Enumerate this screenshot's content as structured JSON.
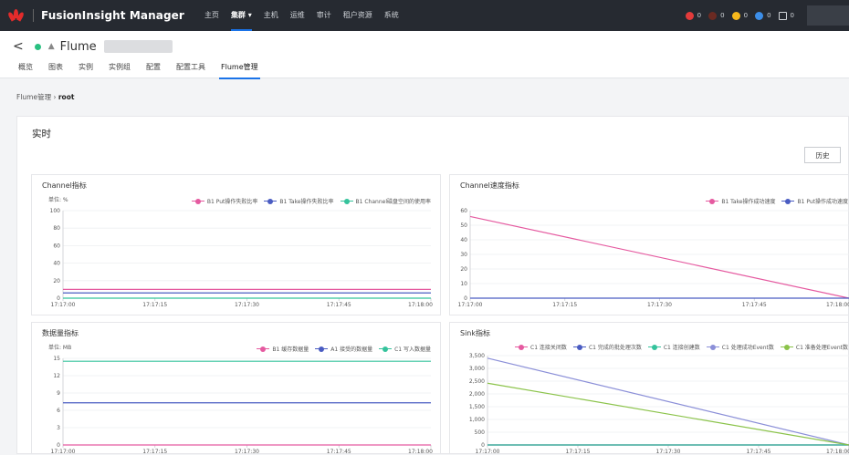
{
  "topbar": {
    "brand": "FusionInsight Manager",
    "nav": [
      "主页",
      "集群 ▾",
      "主机",
      "运维",
      "审计",
      "租户资源",
      "系统"
    ],
    "active_nav": 1,
    "alarms": [
      {
        "color": "#e33b3b",
        "count": "0"
      },
      {
        "color": "#6a2a22",
        "count": "0"
      },
      {
        "color": "#f6b81c",
        "count": "0"
      },
      {
        "color": "#3c8ee8",
        "count": "0"
      },
      {
        "color": "#262a31",
        "count": "0",
        "icon": "list-icon"
      }
    ]
  },
  "service": {
    "name": "Flume"
  },
  "tabs": [
    "概览",
    "图表",
    "实例",
    "实例组",
    "配置",
    "配置工具",
    "Flume管理"
  ],
  "active_tab": 6,
  "breadcrumb": {
    "parent": "Flume管理",
    "current": "root"
  },
  "panel": {
    "title": "实时",
    "history_button": "历史"
  },
  "charts": [
    {
      "title": "Channel指标",
      "unit": "单位: %",
      "xticks": [
        "17:17:00",
        "17:17:15",
        "17:17:30",
        "17:17:45",
        "17:18:00"
      ],
      "yticks": [
        "0",
        "20",
        "40",
        "60",
        "80",
        "100"
      ],
      "legend": [
        {
          "name": "B1 Put操作失败比率",
          "color": "#e55aa0"
        },
        {
          "name": "B1 Take操作失败比率",
          "color": "#4a5cc2"
        },
        {
          "name": "B1 Channel磁盘空间的使用率",
          "color": "#35c39c"
        }
      ]
    },
    {
      "title": "Channel速度指标",
      "unit": "",
      "xticks": [
        "17:17:00",
        "17:17:15",
        "17:17:30",
        "17:17:45",
        "17:18:00"
      ],
      "yticks": [
        "0",
        "10",
        "20",
        "30",
        "40",
        "50",
        "60"
      ],
      "legend": [
        {
          "name": "B1 Take操作成功速度",
          "color": "#e55aa0"
        },
        {
          "name": "B1 Put操作成功速度",
          "color": "#4a5cc2"
        }
      ]
    },
    {
      "title": "数据量指标",
      "unit": "单位: MB",
      "xticks": [
        "17:17:00",
        "17:17:15",
        "17:17:30",
        "17:17:45",
        "17:18:00"
      ],
      "yticks": [
        "0",
        "3",
        "6",
        "9",
        "12",
        "15"
      ],
      "legend": [
        {
          "name": "B1 缓存数据量",
          "color": "#e55aa0"
        },
        {
          "name": "A1 接受的数据量",
          "color": "#4a5cc2"
        },
        {
          "name": "C1 写入数据量",
          "color": "#35c39c"
        }
      ]
    },
    {
      "title": "Sink指标",
      "unit": "",
      "xticks": [
        "17:17:00",
        "17:17:15",
        "17:17:30",
        "17:17:45",
        "17:18:00"
      ],
      "yticks": [
        "0",
        "500",
        "1,000",
        "1,500",
        "2,000",
        "2,500",
        "3,000",
        "3,500"
      ],
      "legend": [
        {
          "name": "C1 连接关闭数",
          "color": "#e55aa0"
        },
        {
          "name": "C1 完成的批处理次数",
          "color": "#4a5cc2"
        },
        {
          "name": "C1 连接创建数",
          "color": "#35c39c"
        },
        {
          "name": "C1 处理成功Event数",
          "color": "#8b8fd8"
        },
        {
          "name": "C1 准备处理Event数",
          "color": "#8bc34a"
        }
      ]
    }
  ],
  "chart_data": [
    {
      "type": "line",
      "title": "Channel指标",
      "ylabel": "单位: %",
      "x": [
        "17:17:00",
        "17:18:00"
      ],
      "ylim": [
        0,
        100
      ],
      "series": [
        {
          "name": "B1 Put操作失败比率",
          "values": [
            10,
            10
          ]
        },
        {
          "name": "B1 Take操作失败比率",
          "values": [
            6,
            6
          ]
        },
        {
          "name": "B1 Channel磁盘空间的使用率",
          "values": [
            0,
            0
          ]
        }
      ]
    },
    {
      "type": "line",
      "title": "Channel速度指标",
      "x": [
        "17:17:00",
        "17:18:00"
      ],
      "ylim": [
        0,
        60
      ],
      "series": [
        {
          "name": "B1 Take操作成功速度",
          "values": [
            56,
            0
          ]
        },
        {
          "name": "B1 Put操作成功速度",
          "values": [
            0,
            0
          ]
        }
      ]
    },
    {
      "type": "line",
      "title": "数据量指标",
      "ylabel": "单位: MB",
      "x": [
        "17:17:00",
        "17:18:00"
      ],
      "ylim": [
        0,
        15
      ],
      "series": [
        {
          "name": "B1 缓存数据量",
          "values": [
            0,
            0
          ]
        },
        {
          "name": "A1 接受的数据量",
          "values": [
            7.3,
            7.3
          ]
        },
        {
          "name": "C1 写入数据量",
          "values": [
            14.5,
            14.5
          ]
        }
      ]
    },
    {
      "type": "line",
      "title": "Sink指标",
      "x": [
        "17:17:00",
        "17:18:00"
      ],
      "ylim": [
        0,
        3500
      ],
      "series": [
        {
          "name": "C1 连接关闭数",
          "values": [
            0,
            0
          ]
        },
        {
          "name": "C1 完成的批处理次数",
          "values": [
            0,
            0
          ]
        },
        {
          "name": "C1 连接创建数",
          "values": [
            0,
            0
          ]
        },
        {
          "name": "C1 处理成功Event数",
          "values": [
            3400,
            0
          ]
        },
        {
          "name": "C1 准备处理Event数",
          "values": [
            2420,
            0
          ]
        }
      ]
    }
  ]
}
